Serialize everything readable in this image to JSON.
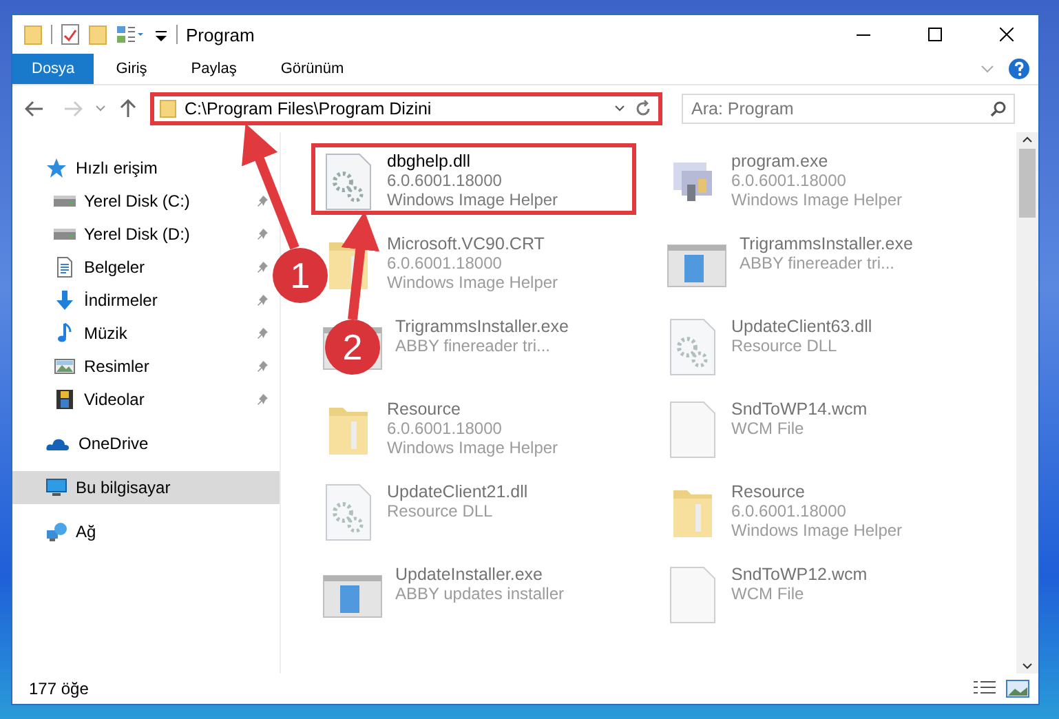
{
  "window": {
    "title": "Program"
  },
  "ribbon_tabs": [
    {
      "label": "Dosya",
      "selected": true
    },
    {
      "label": "Giriş",
      "selected": false
    },
    {
      "label": "Paylaş",
      "selected": false
    },
    {
      "label": "Görünüm",
      "selected": false
    }
  ],
  "address_bar": {
    "path": "C:\\Program Files\\Program Dizini",
    "highlighted": true
  },
  "search": {
    "placeholder": "Ara: Program"
  },
  "sidebar": {
    "items": [
      {
        "label": "Hızlı erişim",
        "kind": "star",
        "pinned": false,
        "selected": false,
        "children": [
          {
            "label": "Yerel Disk (C:)",
            "kind": "drive",
            "pinned": true,
            "selected": false
          },
          {
            "label": "Yerel Disk (D:)",
            "kind": "drive",
            "pinned": true,
            "selected": false
          },
          {
            "label": "Belgeler",
            "kind": "document",
            "pinned": true,
            "selected": false
          },
          {
            "label": "İndirmeler",
            "kind": "download",
            "pinned": true,
            "selected": false
          },
          {
            "label": "Müzik",
            "kind": "music",
            "pinned": true,
            "selected": false
          },
          {
            "label": "Resimler",
            "kind": "pictures",
            "pinned": true,
            "selected": false
          },
          {
            "label": "Videolar",
            "kind": "videos",
            "pinned": true,
            "selected": false
          }
        ]
      },
      {
        "label": "OneDrive",
        "kind": "cloud",
        "pinned": false,
        "selected": false
      },
      {
        "label": "Bu bilgisayar",
        "kind": "computer",
        "pinned": false,
        "selected": true
      },
      {
        "label": "Ağ",
        "kind": "network",
        "pinned": false,
        "selected": false
      }
    ]
  },
  "files": [
    {
      "name": "dbghelp.dll",
      "details": [
        "6.0.6001.18000",
        "Windows Image Helper"
      ],
      "kind": "dll",
      "highlighted": true
    },
    {
      "name": "program.exe",
      "details": [
        "6.0.6001.18000",
        "Windows Image Helper"
      ],
      "kind": "exe",
      "highlighted": false
    },
    {
      "name": "Microsoft.VC90.CRT",
      "details": [
        "6.0.6001.18000",
        "Windows Image Helper"
      ],
      "kind": "folder",
      "highlighted": false
    },
    {
      "name": "TrigrammsInstaller.exe",
      "details": [
        "ABBY finereader tri..."
      ],
      "kind": "installer",
      "highlighted": false
    },
    {
      "name": "TrigrammsInstaller.exe",
      "details": [
        "ABBY finereader tri..."
      ],
      "kind": "installer",
      "highlighted": false
    },
    {
      "name": "UpdateClient63.dll",
      "details": [
        "Resource DLL"
      ],
      "kind": "dll",
      "highlighted": false
    },
    {
      "name": "Resource",
      "details": [
        "6.0.6001.18000",
        "Windows Image Helper"
      ],
      "kind": "folder",
      "highlighted": false
    },
    {
      "name": "SndToWP14.wcm",
      "details": [
        "WCM File"
      ],
      "kind": "file",
      "highlighted": false
    },
    {
      "name": "UpdateClient21.dll",
      "details": [
        "Resource DLL"
      ],
      "kind": "dll",
      "highlighted": false
    },
    {
      "name": "Resource",
      "details": [
        "6.0.6001.18000",
        "Windows Image Helper"
      ],
      "kind": "folder",
      "highlighted": false
    },
    {
      "name": "UpdateInstaller.exe",
      "details": [
        "ABBY updates installer"
      ],
      "kind": "installer",
      "highlighted": false
    },
    {
      "name": "SndToWP12.wcm",
      "details": [
        "WCM File"
      ],
      "kind": "file",
      "highlighted": false
    }
  ],
  "status_bar": {
    "item_count": "177 öğe"
  },
  "annotations": [
    {
      "label": "1"
    },
    {
      "label": "2"
    }
  ]
}
